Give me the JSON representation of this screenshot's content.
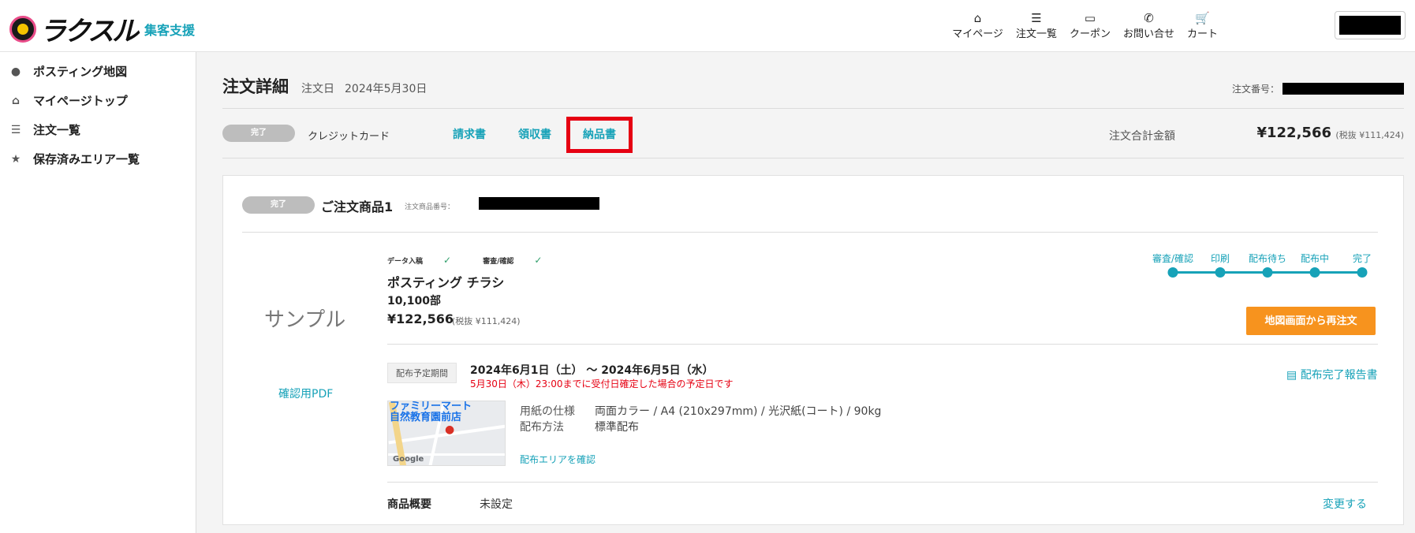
{
  "header": {
    "logo_text": "ラクスル",
    "logo_sub": "集客支援",
    "nav": [
      {
        "icon": "home-icon",
        "glyph": "⌂",
        "label": "マイページ"
      },
      {
        "icon": "list-icon",
        "glyph": "☰",
        "label": "注文一覧"
      },
      {
        "icon": "coupon-icon",
        "glyph": "▭",
        "label": "クーポン"
      },
      {
        "icon": "phone-icon",
        "glyph": "✆",
        "label": "お問い合せ"
      },
      {
        "icon": "cart-icon",
        "glyph": "🛒",
        "label": "カート"
      }
    ]
  },
  "sidebar": {
    "items": [
      {
        "icon": "map-pin-icon",
        "glyph": "●",
        "label": "ポスティング地図"
      },
      {
        "icon": "home-icon",
        "glyph": "⌂",
        "label": "マイページトップ"
      },
      {
        "icon": "list-icon",
        "glyph": "☰",
        "label": "注文一覧"
      },
      {
        "icon": "star-icon",
        "glyph": "★",
        "label": "保存済みエリア一覧"
      }
    ]
  },
  "order": {
    "title": "注文詳細",
    "date_label": "注文日",
    "date": "2024年5月30日",
    "number_label": "注文番号：",
    "status": "完了",
    "payment": "クレジットカード",
    "docs": {
      "invoice": "請求書",
      "receipt": "領収書",
      "delivery": "納品書"
    },
    "total_label": "注文合計金額",
    "total": "¥122,566",
    "total_tax": "(税抜 ¥111,424)"
  },
  "product": {
    "status": "完了",
    "title": "ご注文商品1",
    "number_label": "注文商品番号：",
    "thumb_text": "サンプル",
    "pdf_link": "確認用PDF",
    "checks": [
      "データ入稿",
      "審査/確認"
    ],
    "name": "ポスティング チラシ",
    "quantity": "10,100部",
    "price": "¥122,566",
    "price_tax": "(税抜 ¥111,424)",
    "steps": [
      "審査/確認",
      "印刷",
      "配布待ち",
      "配布中",
      "完了"
    ],
    "reorder_label": "地図画面から再注文",
    "period_tag": "配布予定期間",
    "period": "2024年6月1日（土） ～ 2024年6月5日（水）",
    "period_note": "5月30日（木）23:00までに受付日確定した場合の予定日です",
    "report_link": "配布完了報告書",
    "map_label": "ファミリーマート\n自然教育園前店",
    "map_credit": "Google",
    "spec_label": "用紙の仕様",
    "spec_value": "両面カラー / A4 (210x297mm) / 光沢紙(コート) / 90kg",
    "method_label": "配布方法",
    "method_value": "標準配布",
    "area_link": "配布エリアを確認",
    "summary_label": "商品概要",
    "summary_value": "未設定",
    "change_link": "変更する"
  }
}
